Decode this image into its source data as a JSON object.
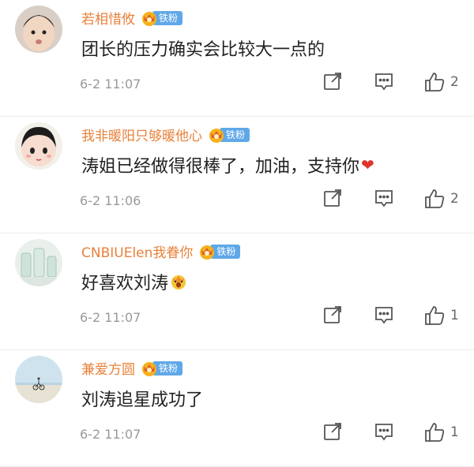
{
  "comments": [
    {
      "username": "若相惜攸",
      "fan_badge": "铁粉",
      "content": "团长的压力确实会比较大一点的",
      "timestamp": "6-2 11:07",
      "like_count": "2",
      "avatar_icon": "avatar-child-photo"
    },
    {
      "username": "我非暖阳只够暖他心",
      "fan_badge": "铁粉",
      "content": "涛姐已经做得很棒了，加油，支持你",
      "content_emoji": "heart-emoji",
      "timestamp": "6-2 11:06",
      "like_count": "2",
      "avatar_icon": "avatar-cartoon-girl"
    },
    {
      "username": "CNBIUElen我眷你",
      "fan_badge": "铁粉",
      "content": "好喜欢刘涛",
      "content_emoji": "awe-face-emoji",
      "timestamp": "6-2 11:07",
      "like_count": "1",
      "avatar_icon": "avatar-glass-bottles"
    },
    {
      "username": "兼爱方圆",
      "fan_badge": "铁粉",
      "content": "刘涛追星成功了",
      "timestamp": "6-2 11:07",
      "like_count": "1",
      "avatar_icon": "avatar-beach-cyclist"
    }
  ],
  "colors": {
    "username": "#e8813a",
    "badge": "#5fa8e8",
    "meta": "#999999",
    "heart": "#e0332c"
  }
}
